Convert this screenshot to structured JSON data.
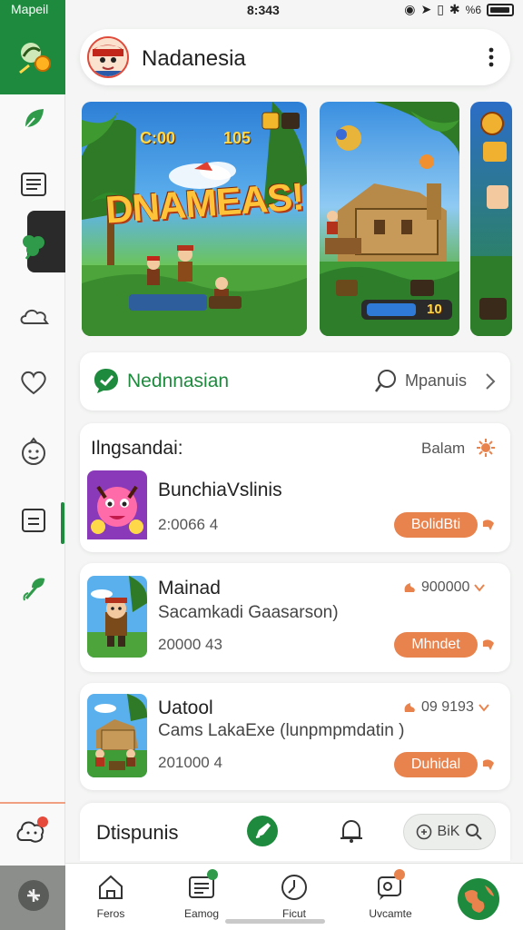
{
  "status_bar": {
    "carrier": "Mapeil",
    "time": "8:343",
    "signal_text": "%6"
  },
  "header": {
    "title": "Nadanesia"
  },
  "banners": {
    "banner1": {
      "hud_coins": "C:00",
      "hud_count": "105",
      "splash": "DNAMEAS!"
    },
    "banner2": {
      "hud_value": "10"
    }
  },
  "search": {
    "brand": "Nednnasian",
    "right_label": "Mpanuis"
  },
  "list_header": {
    "title": "Ilngsandai:",
    "action": "Balam"
  },
  "items": [
    {
      "name": "BunchiaVslinis",
      "meta": "2:0066 4",
      "button": "BolidBti"
    },
    {
      "name": "Mainad",
      "subtitle": "Sacamkadi Gaasarson)",
      "meta": "20000 43",
      "count": "900000",
      "button": "Mhndet"
    },
    {
      "name": "Uatool",
      "subtitle": "Cams LakaExe (lunpmpmdatin )",
      "meta": "201000 4",
      "count": "09 9193",
      "button": "Duhidal"
    }
  ],
  "action_bar": {
    "label": "Dtispunis",
    "search_label": "BiK"
  },
  "bottom_nav": [
    {
      "label": "Feros"
    },
    {
      "label": "Eamog"
    },
    {
      "label": "Ficut"
    },
    {
      "label": "Uvcamte"
    }
  ],
  "colors": {
    "brand_green": "#1e8a3e",
    "accent_orange": "#e9834e"
  }
}
